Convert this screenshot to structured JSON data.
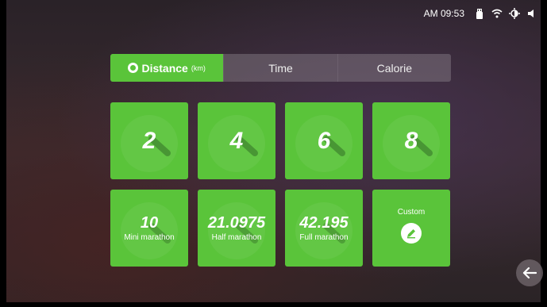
{
  "status": {
    "time": "AM 09:53"
  },
  "tabs": [
    {
      "label": "Distance",
      "unit": "(km)",
      "active": true
    },
    {
      "label": "Time",
      "active": false
    },
    {
      "label": "Calorie",
      "active": false
    }
  ],
  "tiles": [
    {
      "value": "2"
    },
    {
      "value": "4"
    },
    {
      "value": "6"
    },
    {
      "value": "8"
    },
    {
      "value": "10",
      "sub": "Mini marathon"
    },
    {
      "value": "21.0975",
      "sub": "Half marathon"
    },
    {
      "value": "42.195",
      "sub": "Full marathon"
    },
    {
      "label": "Custom"
    }
  ],
  "colors": {
    "accent": "#5ac43a"
  }
}
